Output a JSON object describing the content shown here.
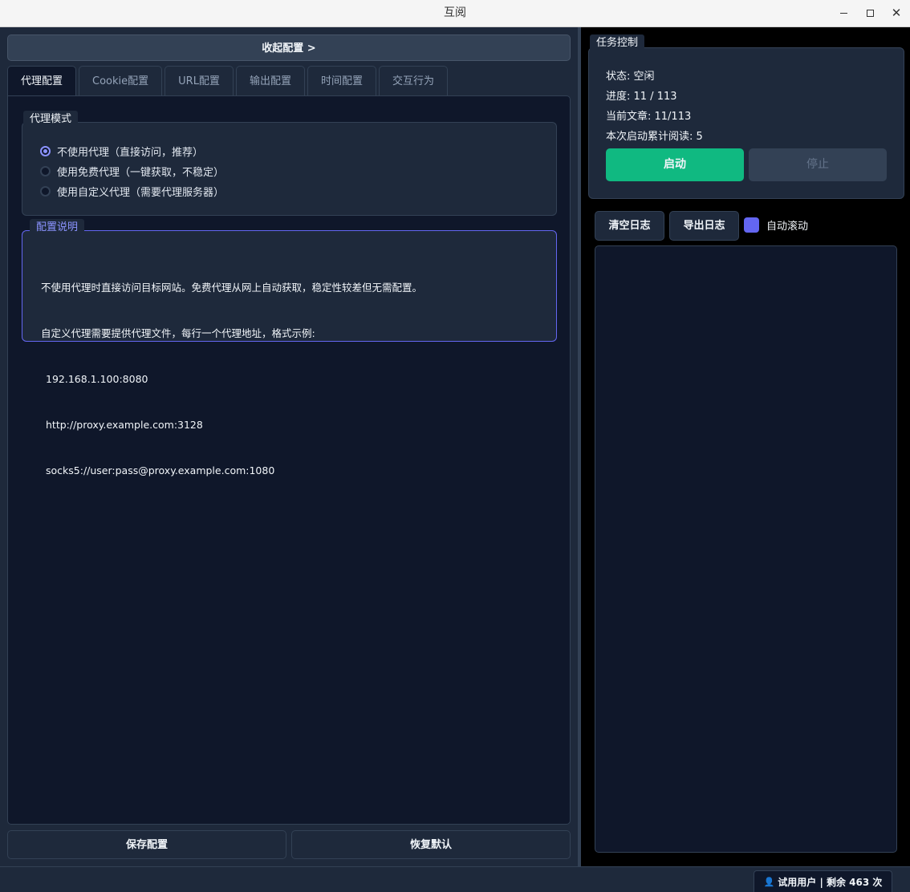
{
  "window": {
    "title": "互阅",
    "close_symbol": "✕"
  },
  "left": {
    "collapse_label": "收起配置 >",
    "tabs": [
      {
        "label": "代理配置",
        "active": true
      },
      {
        "label": "Cookie配置",
        "active": false
      },
      {
        "label": "URL配置",
        "active": false
      },
      {
        "label": "输出配置",
        "active": false
      },
      {
        "label": "时间配置",
        "active": false
      },
      {
        "label": "交互行为",
        "active": false
      }
    ],
    "proxy_mode": {
      "title": "代理模式",
      "options": [
        {
          "label": "不使用代理（直接访问，推荐）",
          "checked": true
        },
        {
          "label": "使用免费代理（一键获取，不稳定）",
          "checked": false
        },
        {
          "label": "使用自定义代理（需要代理服务器）",
          "checked": false
        }
      ]
    },
    "info": {
      "title": "配置说明",
      "lines": [
        "不使用代理时直接访问目标网站。免费代理从网上自动获取，稳定性较差但无需配置。",
        "自定义代理需要提供代理文件，每行一个代理地址，格式示例:",
        "192.168.1.100:8080",
        "http://proxy.example.com:3128",
        "socks5://user:pass@proxy.example.com:1080"
      ]
    },
    "save_label": "保存配置",
    "reset_label": "恢复默认"
  },
  "right": {
    "task": {
      "title": "任务控制",
      "status": "状态: 空闲",
      "progress": "进度: 11 / 113",
      "current_article": "当前文章: 11/113",
      "total_read": "本次启动累计阅读: 5",
      "start_label": "启动",
      "stop_label": "停止"
    },
    "log": {
      "clear_label": "清空日志",
      "export_label": "导出日志",
      "autoscroll_label": "自动滚动",
      "autoscroll_checked": true
    }
  },
  "statusbar": {
    "user_icon": "👤",
    "user_text": "试用用户 | 剩余 463 次"
  },
  "colors": {
    "accent": "#6366f1",
    "start_green": "#10b981",
    "panel_bg": "#1e293b",
    "content_bg": "#0f172a"
  }
}
